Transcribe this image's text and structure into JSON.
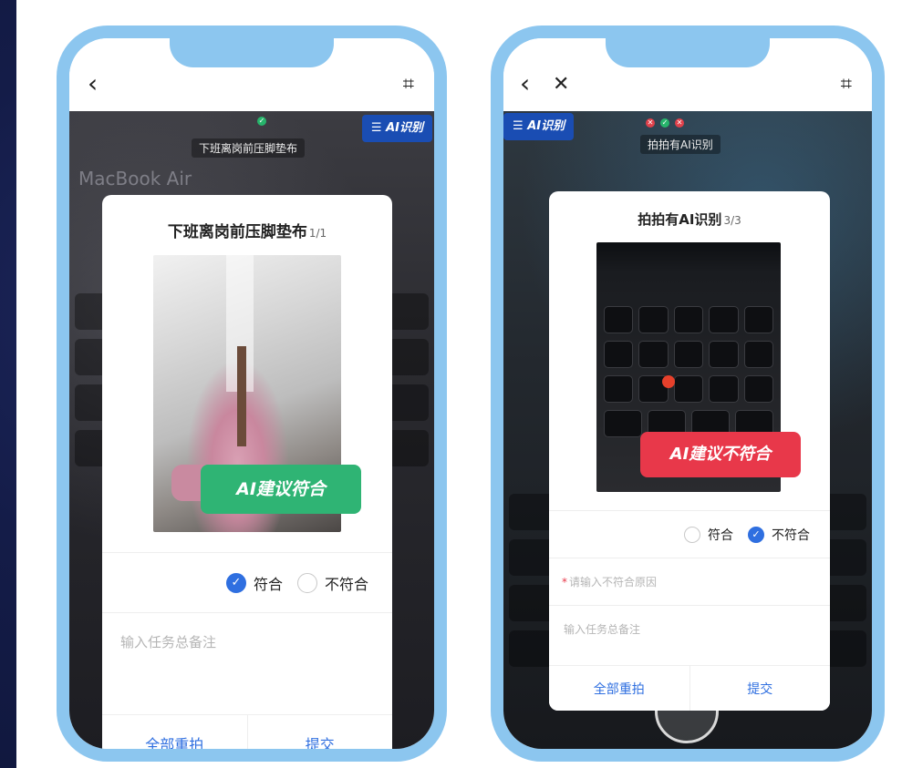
{
  "left_phone": {
    "header": {
      "back_icon": "‹",
      "scan_icon": "⌗"
    },
    "camera": {
      "task_label": "下班离岗前压脚垫布",
      "ai_badge": "AI识别",
      "bg_text": "MacBook Air"
    },
    "modal": {
      "title": "下班离岗前压脚垫布",
      "count": "1/1",
      "verdict": "AI建议符合",
      "verdict_color": "#2fb474",
      "option_pass": "符合",
      "option_fail": "不符合",
      "selected": "符合",
      "remark_placeholder": "输入任务总备注",
      "retake_all": "全部重拍",
      "submit": "提交"
    }
  },
  "right_phone": {
    "header": {
      "back_icon": "‹",
      "close_icon": "✕",
      "scan_icon": "⌗"
    },
    "camera": {
      "task_label": "拍拍有AI识别",
      "ai_badge": "AI识别"
    },
    "modal": {
      "title": "拍拍有AI识别",
      "count": "3/3",
      "verdict": "AI建议不符合",
      "verdict_color": "#e8384a",
      "option_pass": "符合",
      "option_fail": "不符合",
      "selected": "不符合",
      "reason_required_mark": "*",
      "reason_placeholder": "请输入不符合原因",
      "remark_placeholder": "输入任务总备注",
      "retake_all": "全部重拍",
      "submit": "提交"
    }
  },
  "colors": {
    "accent": "#2f6fe0",
    "frame": "#8cc6ef",
    "badge": "#1a4db3"
  }
}
